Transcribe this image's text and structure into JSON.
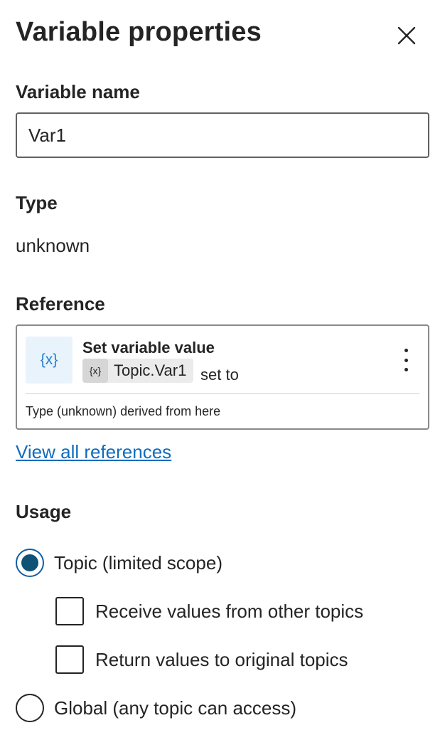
{
  "panel": {
    "title": "Variable properties",
    "close_icon": "close-icon"
  },
  "variable_name": {
    "label": "Variable name",
    "value": "Var1"
  },
  "type": {
    "label": "Type",
    "value": "unknown"
  },
  "reference": {
    "label": "Reference",
    "card": {
      "icon": "variable-icon",
      "icon_glyph": "{x}",
      "action_title": "Set variable value",
      "variable_chip": {
        "icon_glyph": "{x}",
        "label": "Topic.Var1"
      },
      "suffix": "set to",
      "more_icon": "more-vertical-icon",
      "footer": "Type (unknown) derived from here"
    },
    "view_all_link": "View all references"
  },
  "usage": {
    "label": "Usage",
    "options": [
      {
        "label": "Topic (limited scope)",
        "type": "radio",
        "checked": true
      },
      {
        "label": "Receive values from other topics",
        "type": "checkbox",
        "checked": false
      },
      {
        "label": "Return values to original topics",
        "type": "checkbox",
        "checked": false
      },
      {
        "label": "Global (any topic can access)",
        "type": "radio",
        "checked": false
      }
    ]
  },
  "colors": {
    "link": "#0f6cbd",
    "radio_selected": "#0f5275",
    "icon_box_bg": "#e8f3fc",
    "icon_box_fg": "#1f7bcf"
  }
}
